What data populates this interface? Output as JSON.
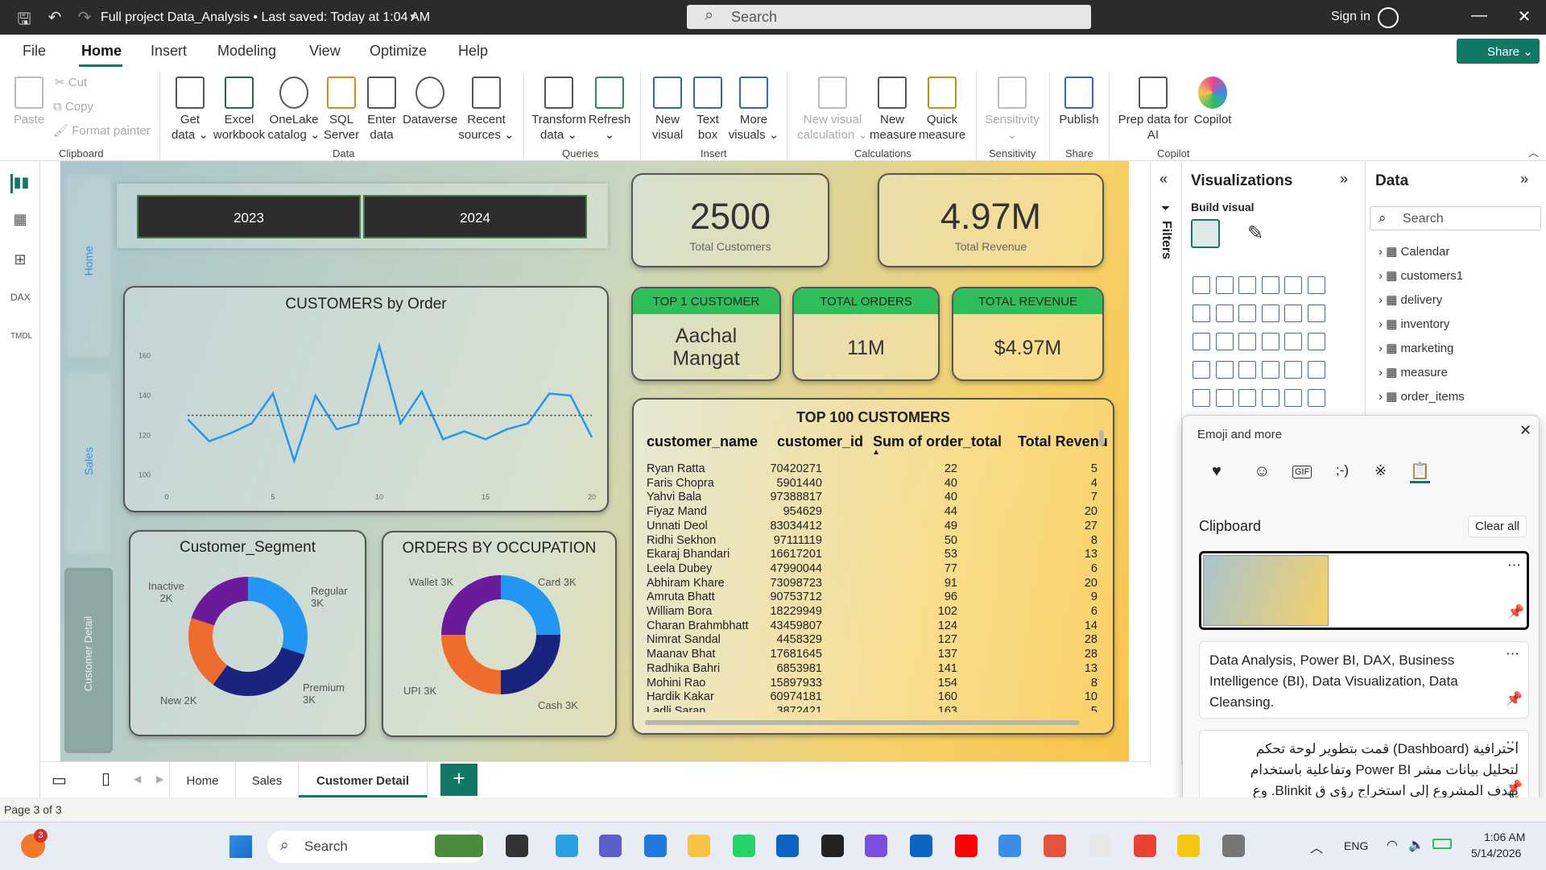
{
  "titlebar": {
    "title": "Full project Data_Analysis • Last saved: Today at 1:04 AM",
    "search": "Search",
    "signin": "Sign in"
  },
  "menu": [
    "File",
    "Home",
    "Insert",
    "Modeling",
    "View",
    "Optimize",
    "Help"
  ],
  "share": "Share",
  "ribbon": {
    "clipboard": {
      "paste": "Paste",
      "cut": "Cut",
      "copy": "Copy",
      "format_painter": "Format painter",
      "group": "Clipboard"
    },
    "data": [
      {
        "l1": "Get",
        "l2": "data ⌄"
      },
      {
        "l1": "Excel",
        "l2": "workbook"
      },
      {
        "l1": "OneLake",
        "l2": "catalog ⌄"
      },
      {
        "l1": "SQL",
        "l2": "Server"
      },
      {
        "l1": "Enter",
        "l2": "data"
      },
      {
        "l1": "Dataverse",
        "l2": ""
      },
      {
        "l1": "Recent",
        "l2": "sources ⌄"
      }
    ],
    "data_group": "Data",
    "queries": [
      {
        "l1": "Transform",
        "l2": "data ⌄"
      },
      {
        "l1": "Refresh",
        "l2": "⌄"
      }
    ],
    "queries_group": "Queries",
    "insert": [
      {
        "l1": "New",
        "l2": "visual"
      },
      {
        "l1": "Text",
        "l2": "box"
      },
      {
        "l1": "More",
        "l2": "visuals ⌄"
      }
    ],
    "insert_group": "Insert",
    "calcs": [
      {
        "l1": "New visual",
        "l2": "calculation ⌄"
      },
      {
        "l1": "New",
        "l2": "measure"
      },
      {
        "l1": "Quick",
        "l2": "measure"
      }
    ],
    "calcs_group": "Calculations",
    "sensitivity": {
      "l1": "Sensitivity",
      "l2": "⌄",
      "group": "Sensitivity"
    },
    "publish": {
      "l1": "Publish",
      "group": "Share"
    },
    "copilot": [
      {
        "l1": "Prep data for",
        "l2": "AI"
      },
      {
        "l1": "Copilot",
        "l2": ""
      }
    ],
    "copilot_group": "Copilot"
  },
  "nav": {
    "home": "Home",
    "sales": "Sales",
    "detail": "Customer Detail"
  },
  "slicer": {
    "y1": "2023",
    "y2": "2024"
  },
  "kpi1": {
    "value": "2500",
    "label": "Total Customers"
  },
  "kpi2": {
    "value": "4.97M",
    "label": "Total Revenue"
  },
  "card1": {
    "header": "TOP 1 CUSTOMER",
    "line1": "Aachal",
    "line2": "Mangat"
  },
  "card2": {
    "header": "TOTAL ORDERS",
    "value": "11M"
  },
  "card3": {
    "header": "TOTAL REVENUE",
    "value": "$4.97M"
  },
  "line_chart": {
    "title": "CUSTOMERS by Order"
  },
  "donut1": {
    "title": "Customer_Segment",
    "l_inactive_a": "Inactive",
    "l_inactive_b": "2K",
    "l_regular_a": "Regular",
    "l_regular_b": "3K",
    "l_new": "New 2K",
    "l_premium_a": "Premium",
    "l_premium_b": "3K"
  },
  "donut2": {
    "title": "ORDERS BY OCCUPATION",
    "l_wallet": "Wallet 3K",
    "l_card": "Card 3K",
    "l_upi": "UPI 3K",
    "l_cash": "Cash 3K"
  },
  "chart_data": [
    {
      "type": "line",
      "title": "CUSTOMERS by Order",
      "x": [
        0,
        1,
        2,
        3,
        4,
        5,
        6,
        7,
        8,
        9,
        10,
        11,
        12,
        13,
        14,
        15,
        16,
        17,
        18,
        19,
        20
      ],
      "values": [
        140,
        128,
        117,
        121,
        126,
        141,
        107,
        140,
        123,
        126,
        165,
        126,
        142,
        118,
        122,
        118,
        123,
        126,
        141,
        140,
        119
      ],
      "average": 130,
      "xticks": [
        0,
        5,
        10,
        15,
        20
      ],
      "yticks": [
        100,
        120,
        140,
        160
      ],
      "ylim": [
        95,
        170
      ],
      "colors": [
        "#2196f3"
      ]
    },
    {
      "type": "pie",
      "title": "Customer_Segment",
      "labels": [
        "Regular",
        "Premium",
        "New",
        "Inactive"
      ],
      "values": [
        3,
        3,
        2,
        2
      ],
      "colors": [
        "#2196f3",
        "#1a237e",
        "#ef6c2c",
        "#6a1b9a"
      ]
    },
    {
      "type": "pie",
      "title": "ORDERS BY OCCUPATION",
      "labels": [
        "Card",
        "Cash",
        "UPI",
        "Wallet"
      ],
      "values": [
        3,
        3,
        3,
        3
      ],
      "colors": [
        "#2196f3",
        "#1a237e",
        "#ef6c2c",
        "#6a1b9a"
      ]
    }
  ],
  "table": {
    "title": "TOP 100 CUSTOMERS",
    "headers": [
      "customer_name",
      "customer_id",
      "Sum of order_total",
      "Total Revenu"
    ],
    "rows": [
      [
        "Ryan Ratta",
        "70420271",
        "22",
        "5"
      ],
      [
        "Faris Chopra",
        "5901440",
        "40",
        "4"
      ],
      [
        "Yahvi Bala",
        "97388817",
        "40",
        "7"
      ],
      [
        "Fiyaz Mand",
        "954629",
        "44",
        "20"
      ],
      [
        "Unnati Deol",
        "83034412",
        "49",
        "27"
      ],
      [
        "Ridhi Sekhon",
        "97111119",
        "50",
        "8"
      ],
      [
        "Ekaraj Bhandari",
        "16617201",
        "53",
        "13"
      ],
      [
        "Leela Dubey",
        "47990044",
        "77",
        "6"
      ],
      [
        "Abhiram Khare",
        "73098723",
        "91",
        "20"
      ],
      [
        "Amruta Bhatt",
        "90753712",
        "96",
        "9"
      ],
      [
        "William Bora",
        "18229949",
        "102",
        "6"
      ],
      [
        "Charan Brahmbhatt",
        "43459807",
        "124",
        "14"
      ],
      [
        "Nimrat Sandal",
        "4458329",
        "127",
        "28"
      ],
      [
        "Maanav Bhat",
        "17681645",
        "137",
        "28"
      ],
      [
        "Radhika Bahri",
        "6853981",
        "141",
        "13"
      ],
      [
        "Mohini Rao",
        "15897933",
        "154",
        "8"
      ],
      [
        "Hardik Kakar",
        "60974181",
        "160",
        "10"
      ],
      [
        "Ladli Saran",
        "3872421",
        "163",
        "5"
      ]
    ]
  },
  "panes": {
    "visualizations": "Visualizations",
    "build": "Build visual",
    "data": "Data",
    "filters": "Filters",
    "search": "Search",
    "tables": [
      "Calendar",
      "customers1",
      "delivery",
      "inventory",
      "marketing",
      "measure",
      "order_items"
    ]
  },
  "emoji": {
    "title": "Emoji and more",
    "clipboard": "Clipboard",
    "clear": "Clear all",
    "clip2": "Data Analysis, Power BI, DAX, Business Intelligence (BI), Data Visualization, Data Cleansing.",
    "clip3": "احترافية (Dashboard) قمت بتطوير لوحة تحكم لتحليل بيانات مشر Power BI وتفاعلية باستخدام يهدف المشروع إلى استخراج رؤى ق Blinkit. وع"
  },
  "tabs": [
    "Home",
    "Sales",
    "Customer Detail"
  ],
  "status": {
    "page": "Page 3 of 3"
  },
  "taskbar": {
    "search": "Search",
    "lang": "ENG",
    "time": "1:06 AM",
    "date": "5/14/2026",
    "badge": "3"
  }
}
